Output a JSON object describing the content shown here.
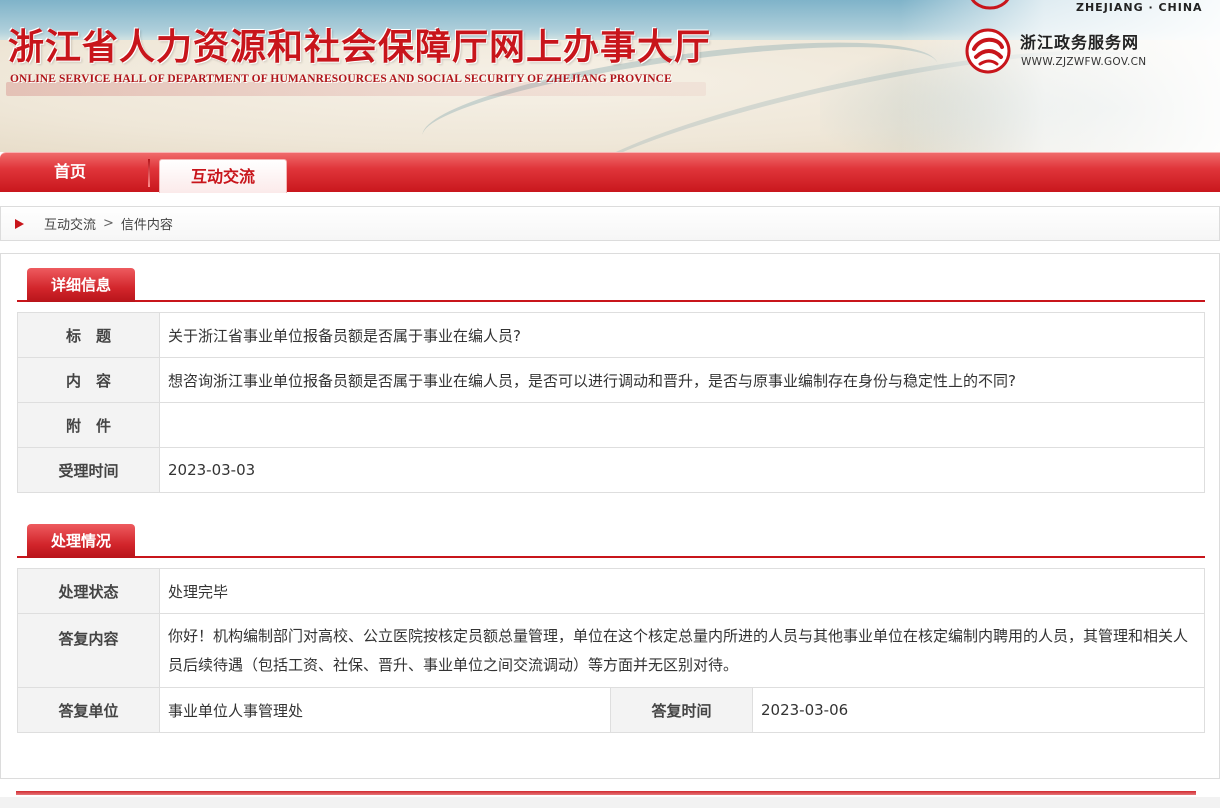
{
  "header": {
    "title": "浙江省人力资源和社会保障厅网上办事大厅",
    "subtitle": "ONLINE SERVICE HALL OF DEPARTMENT OF HUMANRESOURCES AND SOCIAL SECURITY OF ZHEJIANG PROVINCE",
    "region_label": "ZHEJIANG · CHINA",
    "gov_portal_name": "浙江政务服务网",
    "gov_portal_url": "WWW.ZJZWFW.GOV.CN"
  },
  "nav": {
    "items": [
      {
        "label": "首页"
      },
      {
        "label": "互动交流"
      }
    ],
    "active": "互动交流"
  },
  "breadcrumb": {
    "items": [
      "互动交流",
      "信件内容"
    ],
    "separator": ">"
  },
  "detail": {
    "section_title": "详细信息",
    "rows": [
      {
        "label": "标　题",
        "value": "关于浙江省事业单位报备员额是否属于事业在编人员?"
      },
      {
        "label": "内　容",
        "value": "想咨询浙江事业单位报备员额是否属于事业在编人员，是否可以进行调动和晋升，是否与原事业编制存在身份与稳定性上的不同?"
      },
      {
        "label": "附　件",
        "value": ""
      },
      {
        "label": "受理时间",
        "value": "2023-03-03"
      }
    ]
  },
  "processing": {
    "section_title": "处理情况",
    "status_label": "处理状态",
    "status_value": "处理完毕",
    "reply_label": "答复内容",
    "reply_value": "你好！机构编制部门对高校、公立医院按核定员额总量管理，单位在这个核定总量内所进的人员与其他事业单位在核定编制内聘用的人员，其管理和相关人员后续待遇（包括工资、社保、晋升、事业单位之间交流调动）等方面并无区别对待。",
    "unit_label": "答复单位",
    "unit_value": "事业单位人事管理处",
    "time_label": "答复时间",
    "time_value": "2023-03-06"
  },
  "colors": {
    "brand_red": "#c8151b",
    "label_bg": "#f3f3f3",
    "border": "#dedede"
  },
  "icons": {
    "gov_logo": "zjzwfw-swirl-logo-icon",
    "breadcrumb_marker": "triangle-right-icon"
  }
}
